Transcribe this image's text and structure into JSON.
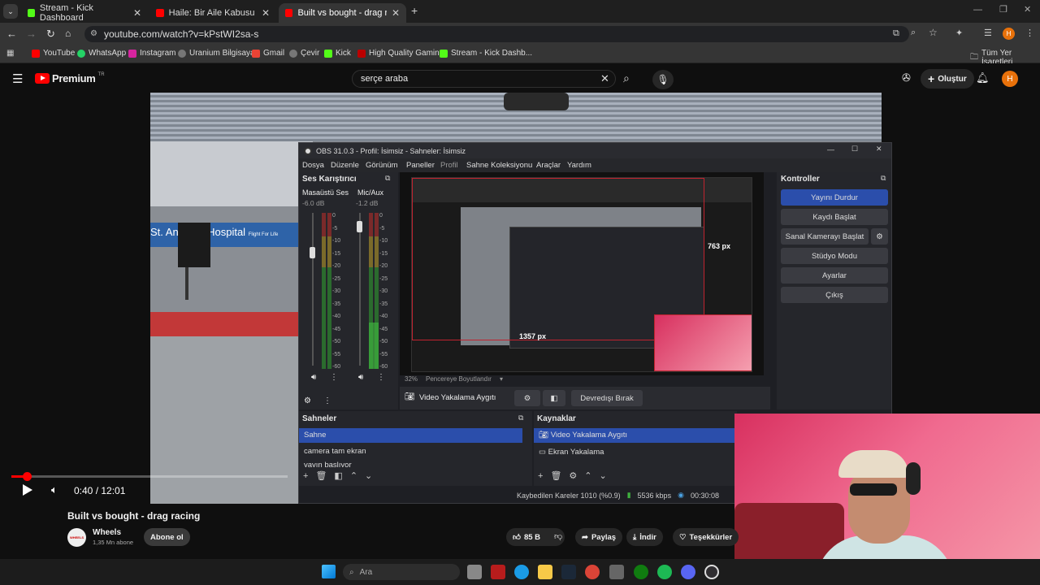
{
  "browser": {
    "tabs": [
      {
        "title": "Stream - Kick Dashboard",
        "active": false
      },
      {
        "title": "Haile: Bir Aile Kabusu (Ömer Ge",
        "active": false
      },
      {
        "title": "Built vs bought - drag racing -",
        "active": true
      }
    ],
    "url": "youtube.com/watch?v=kPstWI2sa-s",
    "profile_initial": "H",
    "bookmarks": [
      "YouTube",
      "WhatsApp",
      "Instagram",
      "Uranium Bilgisayar",
      "Gmail",
      "Çevir",
      "Kick",
      "High Quality Gamin...",
      "Stream - Kick Dashb..."
    ],
    "all_bookmarks": "Tüm Yer İşaretleri"
  },
  "youtube": {
    "logo_text": "Premium",
    "logo_sup": "TR",
    "search_value": "serçe araba",
    "create_label": "Oluştur",
    "avatar_initial": "H",
    "video_title": "Built vs bought - drag racing",
    "channel_name": "Wheels",
    "channel_subs": "1,35 Mn abone",
    "channel_badge": "WHEELS",
    "subscribe_label": "Abone ol",
    "likes": "85 B",
    "share_label": "Paylaş",
    "download_label": "İndir",
    "thanks_label": "Teşekkürler",
    "time": "0:40 / 12:01",
    "progress": 0.055,
    "video_sign": "St. Anthony Hospital",
    "video_sign2": "Flight For Life"
  },
  "obs": {
    "window_title": "OBS 31.0.3 - Profil: İsimsiz - Sahneler: İsimsiz",
    "menu": [
      "Dosya",
      "Düzenle",
      "Görünüm",
      "Paneller",
      "Profil",
      "Sahne Koleksiyonu",
      "Araçlar",
      "Yardım"
    ],
    "mixer_title": "Ses Karıştırıcı",
    "channels": [
      {
        "name": "Masaüstü Ses",
        "db": "-6.0 dB"
      },
      {
        "name": "Mic/Aux",
        "db": "-1.2 dB"
      }
    ],
    "meter_ticks": [
      "0",
      "-5",
      "-10",
      "-15",
      "-20",
      "-25",
      "-30",
      "-35",
      "-40",
      "-45",
      "-50",
      "-55",
      "-60"
    ],
    "preview_label_h": "763 px",
    "preview_label_w": "1357 px",
    "zoom": "32%",
    "zoom_mode": "Pencereye Boyutlandır",
    "source_toolbar_name": "Video Yakalama Aygıtı",
    "deactivate_label": "Devredışı Bırak",
    "controls_title": "Kontroller",
    "controls": [
      "Yayını Durdur",
      "Kaydı Başlat",
      "Sanal Kamerayı Başlat",
      "Stüdyo Modu",
      "Ayarlar",
      "Çıkış"
    ],
    "scenes_title": "Sahneler",
    "scenes": [
      "Sahne",
      "camera tam ekran",
      "yayın başlıyor"
    ],
    "sources_title": "Kaynaklar",
    "sources": [
      "Video Yakalama Aygıtı",
      "Ekran Yakalama"
    ],
    "status_dropped": "Kaybedilen Kareler 1010 (%0.9)",
    "status_bitrate": "5536 kbps",
    "status_time": "00:30:08"
  },
  "taskbar": {
    "search_placeholder": "Ara"
  },
  "colors": {
    "obs_accent": "#2b4eab",
    "yt_red": "#ff0000",
    "kick_green": "#53fc18",
    "obs_rec_red": "#c0232f"
  }
}
